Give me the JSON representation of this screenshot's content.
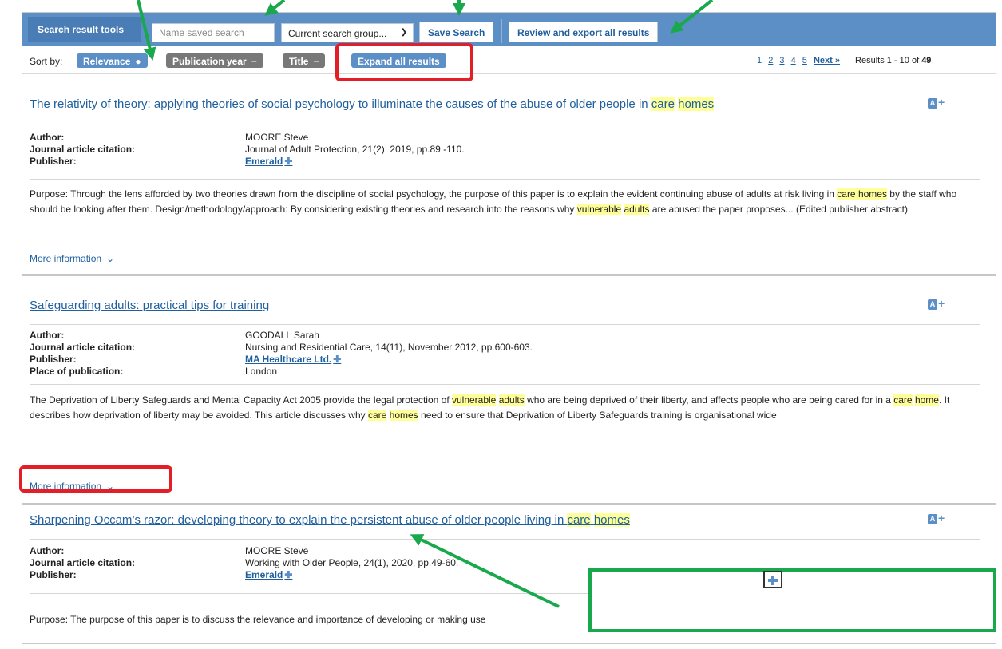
{
  "toolbar": {
    "tools_label": "Search result tools",
    "name_placeholder": "Name saved search",
    "group_select": "Current search group...",
    "save_label": "Save Search",
    "review_label": "Review and export all results"
  },
  "sort": {
    "label": "Sort by:",
    "options": [
      {
        "label": "Relevance",
        "mark": "●"
      },
      {
        "label": "Publication year",
        "mark": "−"
      },
      {
        "label": "Title",
        "mark": "−"
      }
    ],
    "expand_label": "Expand all results"
  },
  "pager": {
    "pages": [
      "1",
      "2",
      "3",
      "4",
      "5"
    ],
    "next": "Next »",
    "results_prefix": "Results 1 - 10 of",
    "results_total": "49"
  },
  "records": [
    {
      "title_plain": "The relativity of theory: applying theories of social psychology to illuminate the causes of the abuse of older people in",
      "title_hl1": "care",
      "title_hl2": "homes",
      "author_label": "Author:",
      "author": "MOORE Steve",
      "citation_label": "Journal article citation:",
      "citation": "Journal of Adult Protection, 21(2), 2019, pp.89 -110.",
      "publisher_label": "Publisher:",
      "publisher": "Emerald",
      "abstract": {
        "p1": "Purpose: Through the lens afforded by two theories drawn from the discipline of social psychology, the purpose of this paper is to explain the evident continuing abuse of adults at risk living in ",
        "h1": "care homes",
        "p2": " by the staff who should be looking after them. Design/methodology/approach: By considering existing theories and research into the reasons why ",
        "h2": "vulnerable",
        "p3": " ",
        "h3": "adults",
        "p4": " are abused the paper proposes... (Edited publisher abstract)"
      },
      "more": "More information"
    },
    {
      "title_plain": "Safeguarding adults: practical tips for training",
      "author_label": "Author:",
      "author": "GOODALL Sarah",
      "citation_label": "Journal article citation:",
      "citation": "Nursing and Residential Care, 14(11), November 2012, pp.600-603.",
      "publisher_label": "Publisher:",
      "publisher": "MA Healthcare Ltd.",
      "place_label": "Place of publication:",
      "place": "London",
      "abstract": {
        "p1": "The Deprivation of Liberty Safeguards and Mental Capacity Act 2005 provide the legal protection of ",
        "h1": "vulnerable",
        "p2": " ",
        "h2": "adults",
        "p3": " who are being deprived of their liberty, and affects people who are being cared for in a ",
        "h3": "care",
        "p4": " ",
        "h4": "home",
        "p5": ". It describes how deprivation of liberty may be avoided. This article discusses why ",
        "h5": "care",
        "p6": " ",
        "h6": "homes",
        "p7": " need to ensure that Deprivation of Liberty Safeguards training is organisational wide"
      },
      "more": "More information"
    },
    {
      "title_plain": "Sharpening Occam’s razor: developing theory to explain the persistent abuse of older people living in",
      "title_hl1": "care",
      "title_hl2": "homes",
      "author_label": "Author:",
      "author": "MOORE Steve",
      "citation_label": "Journal article citation:",
      "citation": "Working with Older People, 24(1), 2020, pp.49-60.",
      "publisher_label": "Publisher:",
      "publisher": "Emerald",
      "abstract_partial": "Purpose: The purpose of this paper is to discuss the relevance and importance of developing or making use"
    }
  ],
  "colors": {
    "toolbar": "#5b8fc6",
    "link": "#1f5f9e",
    "highlight": "#ffff99",
    "annotation_red": "#e41e26",
    "annotation_green": "#19a84b"
  }
}
